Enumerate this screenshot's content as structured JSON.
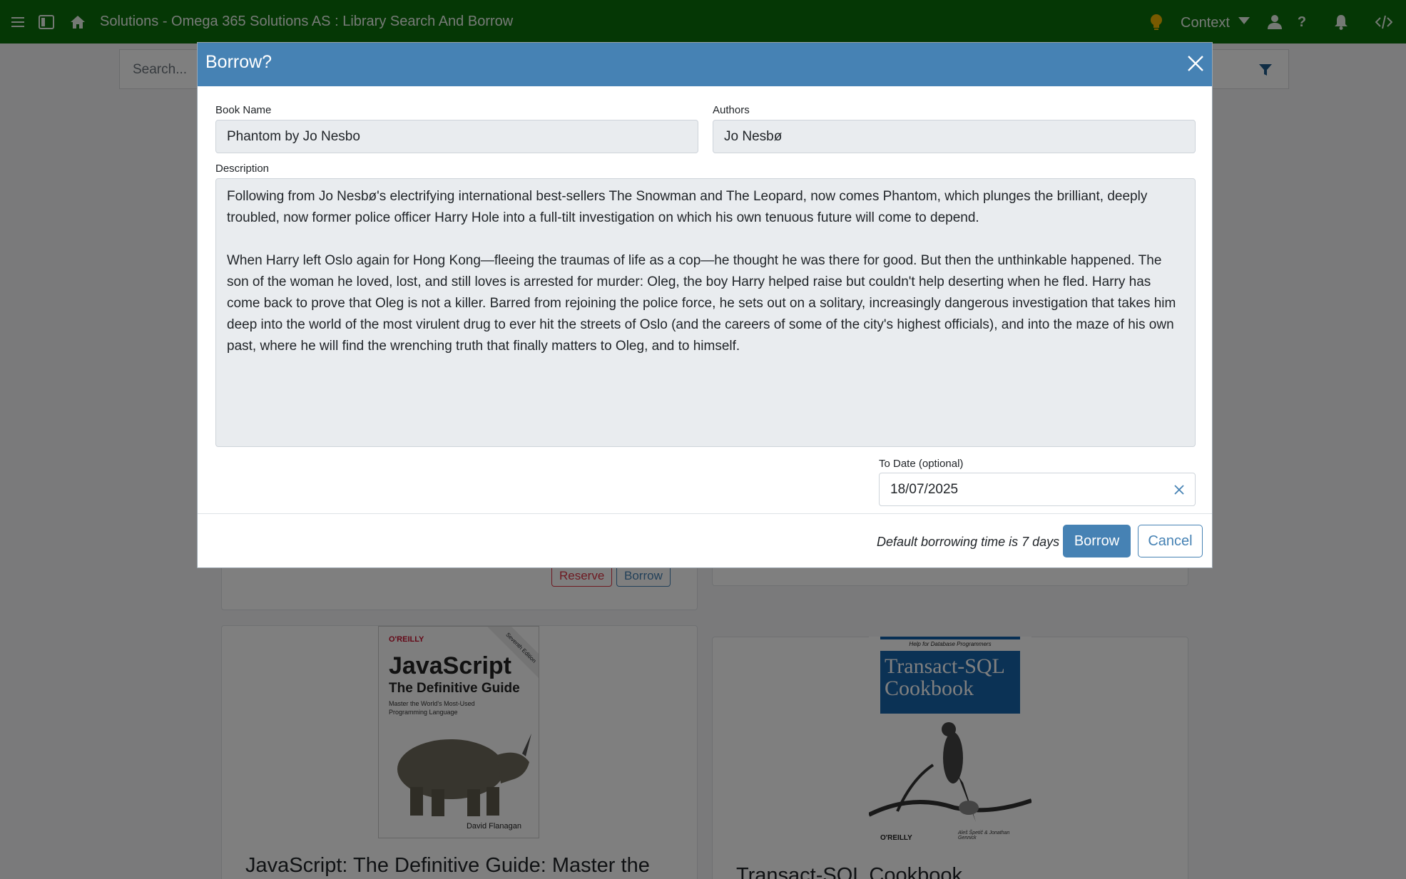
{
  "topbar": {
    "title": "Solutions - Omega 365 Solutions AS : Library Search And Borrow",
    "context_label": "Context",
    "icons": [
      "menu-icon",
      "sidebar-toggle-icon",
      "home-icon",
      "lightbulb-icon",
      "chevron-down-icon",
      "user-icon",
      "help-icon",
      "bell-icon",
      "code-icon"
    ],
    "bg_color": "#0b6e0b",
    "lightbulb_color": "#f0b400"
  },
  "page": {
    "search_placeholder": "Search...",
    "cards": [
      {
        "reserve_label": "Reserve",
        "borrow_label": "Borrow"
      },
      {
        "title": "JavaScript: The Definitive Guide: Master the",
        "cover": {
          "publisher": "O'REILLY",
          "title": "JavaScript",
          "subtitle": "The Definitive Guide",
          "tagline": "Master the World's Most-Used Programming Language",
          "author": "David Flanagan",
          "edition": "Seventh Edition"
        }
      },
      {
        "title": "Transact-SQL Cookbook",
        "cover": {
          "top_note": "Help for Database Programmers",
          "title": "Transact-SQL Cookbook",
          "publisher": "O'REILLY",
          "authors": "Aleš Špetič & Jonathan Gennick"
        }
      }
    ]
  },
  "modal": {
    "title": "Borrow?",
    "book_name_label": "Book Name",
    "book_name_value": "Phantom by Jo Nesbo",
    "authors_label": "Authors",
    "authors_value": "Jo Nesbø",
    "description_label": "Description",
    "description_value": "Following from Jo Nesbø's electrifying international best-sellers The Snowman and The Leopard, now comes Phantom, which plunges the brilliant, deeply troubled, now former police officer Harry Hole into a full-tilt investigation on which his own tenuous future will come to depend.\n\nWhen Harry left Oslo again for Hong Kong—fleeing the traumas of life as a cop—he thought he was there for good. But then the unthinkable happened. The son of the woman he loved, lost, and still loves is arrested for murder: Oleg, the boy Harry helped raise but couldn't help deserting when he fled. Harry has come back to prove that Oleg is not a killer. Barred from rejoining the police force, he sets out on a solitary, increasingly dangerous investigation that takes him deep into the world of the most virulent drug to ever hit the streets of Oslo (and the careers of some of the city's highest officials), and into the maze of his own past, where he will find the wrenching truth that finally matters to Oleg, and to himself.",
    "to_date_label": "To Date (optional)",
    "to_date_value": "18/07/2025",
    "footer_note": "Default borrowing time is 7 days",
    "borrow_label": "Borrow",
    "cancel_label": "Cancel",
    "accent_color": "#4682b4"
  }
}
